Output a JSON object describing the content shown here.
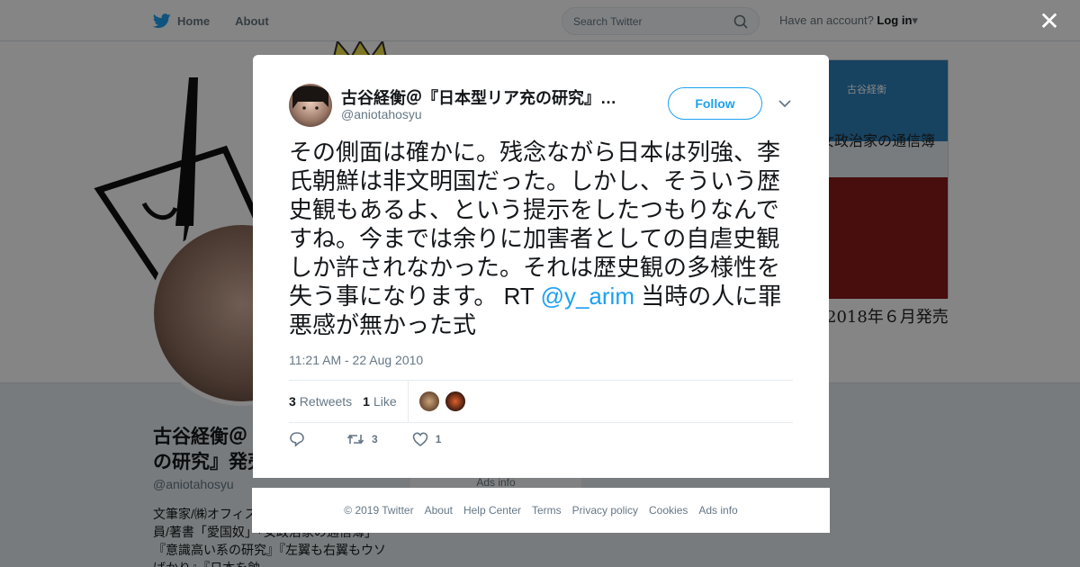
{
  "nav": {
    "home": "Home",
    "about": "About",
    "search_placeholder": "Search Twitter",
    "have_account": "Have an account?",
    "login": "Log in"
  },
  "background": {
    "release": "2018年６月発売",
    "name_line1": "古谷経衡＠",
    "name_line2": "の研究』発売",
    "handle": "@aniotahosyu",
    "bio": "文筆家/㈱オフィス・…本ペンクラブ正会員/著書「愛国奴」「女政治家の通信簿」『意識高い系の研究』『左翼も右翼もウソばかり』『日本を蝕",
    "ads_info": "Ads info",
    "book_title": "女政治家の通信簿",
    "book_author": "古谷経衡"
  },
  "tweet": {
    "author_name": "古谷経衡＠『日本型リア充の研究』…",
    "author_handle": "@aniotahosyu",
    "follow_label": "Follow",
    "text_before": "その側面は確かに。残念ながら日本は列強、李氏朝鮮は非文明国だった。しかし、そういう歴史観もあるよ、という提示をしたつもりなんですね。今までは余りに加害者としての自虐史観しか許されなかった。それは歴史観の多様性を失う事になります。 RT ",
    "mention": "@y_arim",
    "text_after": " 当時の人に罪悪感が無かった式",
    "timestamp": "11:21 AM - 22 Aug 2010",
    "retweets_count": "3",
    "retweets_label": "Retweets",
    "likes_count": "1",
    "likes_label": "Like",
    "action_retweets": "3",
    "action_likes": "1"
  },
  "footer": [
    "© 2019 Twitter",
    "About",
    "Help Center",
    "Terms",
    "Privacy policy",
    "Cookies",
    "Ads info"
  ],
  "colors": {
    "accent": "#1da1f2",
    "overlay": "rgba(0,0,0,0.48)"
  }
}
